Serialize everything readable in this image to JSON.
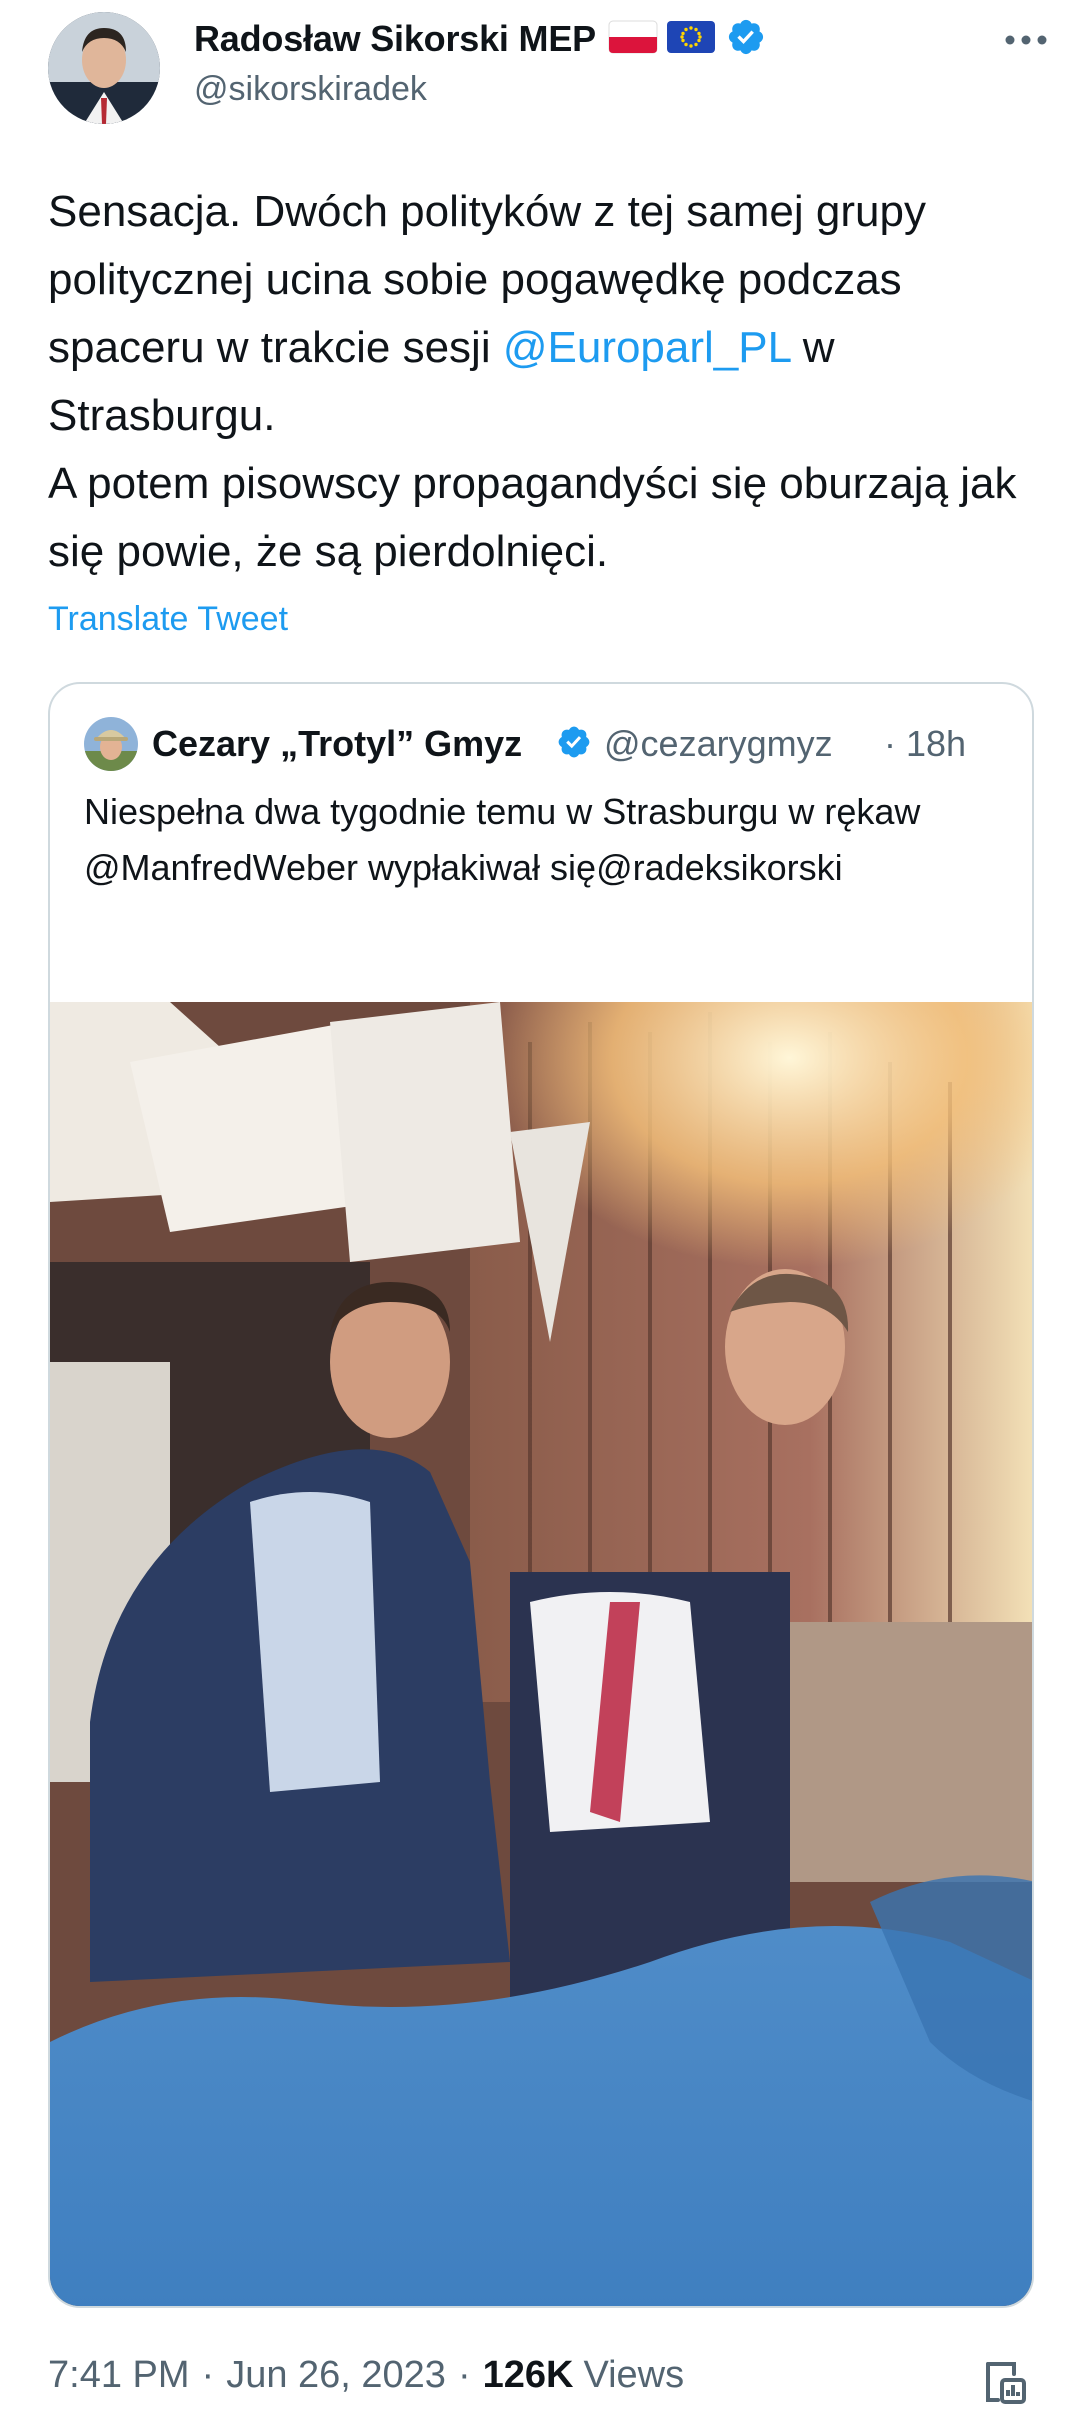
{
  "author": {
    "display_name": "Radosław Sikorski MEP",
    "handle": "@sikorskiradek",
    "flags": [
      "poland-flag-icon",
      "eu-flag-icon"
    ],
    "verified_icon": "verified-badge-icon"
  },
  "tweet": {
    "text_line1": "Sensacja. Dwóch polityków z tej samej grupy politycznej ucina sobie pogawędkę podczas spaceru w trakcie sesji ",
    "mention": "@Europarl_PL",
    "text_line2": " w Strasburgu.\nA potem pisowscy propagandyści się oburzają jak się powie, że są pierdolnięci.",
    "translate_label": "Translate Tweet"
  },
  "quote": {
    "display_name": "Cezary „Trotyl” Gmyz",
    "handle": "@cezarygmyz",
    "separator": "·",
    "time": "18h",
    "text": "Niespełna dwa tygodnie temu w Strasburgu w rękaw @ManfredWeber wypłakiwał się@radeksikorski"
  },
  "meta": {
    "time": "7:41 PM",
    "separator": "·",
    "date": "Jun 26, 2023",
    "views_count": "126K",
    "views_label": "Views"
  },
  "colors": {
    "accent": "#1d9bf0",
    "secondary_text": "#536471",
    "border": "#cfd9de"
  }
}
